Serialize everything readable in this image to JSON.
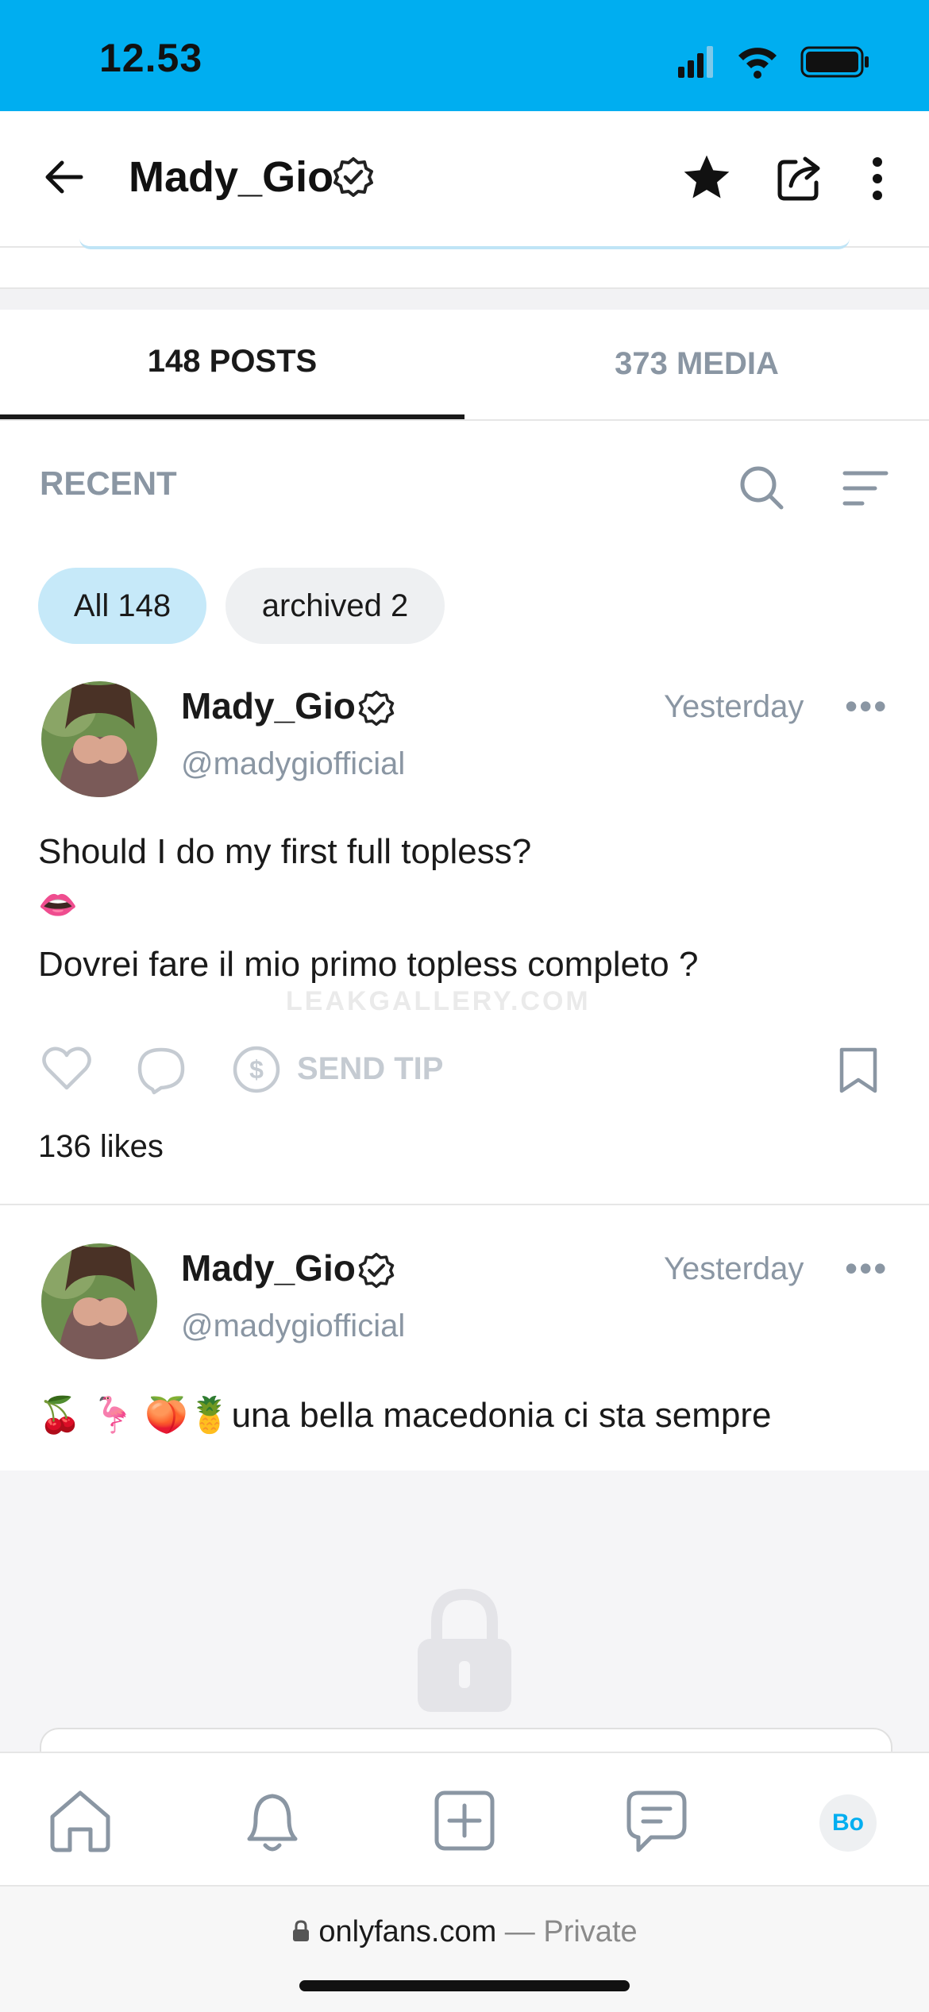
{
  "status": {
    "time": "12.53"
  },
  "header": {
    "title": "Mady_Gio"
  },
  "tabs": [
    {
      "label": "148 POSTS",
      "active": true
    },
    {
      "label": "373 MEDIA",
      "active": false
    }
  ],
  "filter": {
    "label": "RECENT"
  },
  "chips": [
    {
      "label": "All 148",
      "selected": true
    },
    {
      "label": "archived 2",
      "selected": false
    }
  ],
  "posts": [
    {
      "name": "Mady_Gio",
      "handle": "@madygiofficial",
      "time": "Yesterday",
      "line1": "Should I do my first full topless?",
      "line2": "👄",
      "line3": "Dovrei fare il mio primo topless completo ?",
      "send_tip": "SEND TIP",
      "likes": "136 likes"
    },
    {
      "name": "Mady_Gio",
      "handle": "@madygiofficial",
      "time": "Yesterday",
      "text": "🍒 🦩 🍑🍍una bella macedonia ci sta sempre"
    }
  ],
  "watermark": "LEAKGALLERY.COM",
  "bottom_nav": {
    "avatar_initials": "Bo"
  },
  "url_bar": {
    "domain": "onlyfans.com",
    "suffix": " — Private"
  },
  "colors": {
    "accent": "#00aef0",
    "muted": "#8a96a3",
    "chip_selected": "#c6e9f9"
  },
  "icons": [
    "back-arrow-icon",
    "verified-badge-icon",
    "star-icon",
    "share-icon",
    "more-vertical-icon",
    "search-icon",
    "sort-icon",
    "more-horizontal-icon",
    "heart-icon",
    "comment-icon",
    "dollar-icon",
    "bookmark-icon",
    "lock-icon",
    "home-icon",
    "bell-icon",
    "add-icon",
    "message-icon"
  ]
}
